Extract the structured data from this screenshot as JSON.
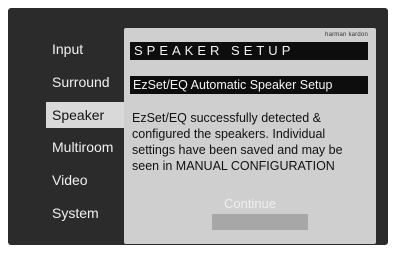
{
  "menu": {
    "items": [
      {
        "label": "Input",
        "selected": false
      },
      {
        "label": "Surround",
        "selected": false
      },
      {
        "label": "Speaker",
        "selected": true
      },
      {
        "label": "Multiroom",
        "selected": false
      },
      {
        "label": "Video",
        "selected": false
      },
      {
        "label": "System",
        "selected": false
      }
    ]
  },
  "dialog": {
    "brand": "harman kardon",
    "title": "SPEAKER SETUP",
    "subtitle": "EzSet/EQ Automatic Speaker Setup",
    "message": "EzSet/EQ successfully detected &\nconfigured the speakers. Individual\nsettings have been saved and may be\nseen in MANUAL CONFIGURATION",
    "continue_label": "Continue"
  },
  "colors": {
    "screen_bg": "#2b2b2b",
    "dialog_bg": "#cfcfcf",
    "selected_bg": "#d9d9d9",
    "button_bg": "#a7a7a7"
  }
}
